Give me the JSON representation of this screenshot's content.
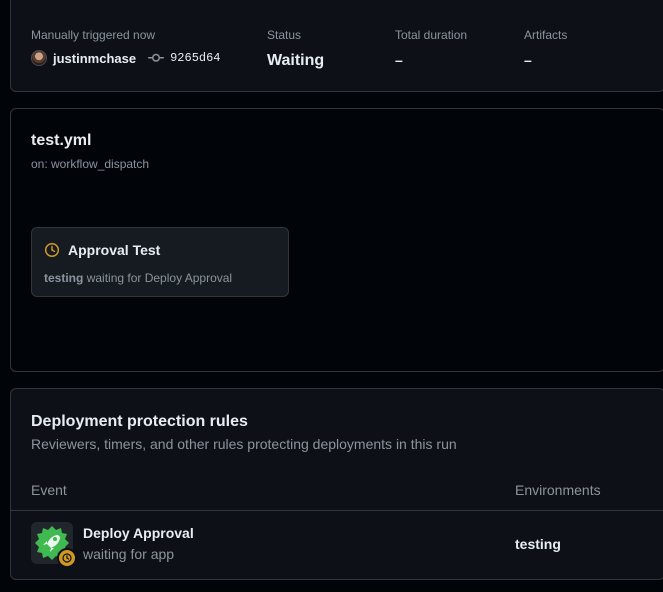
{
  "summary": {
    "trigger_label": "Manually triggered now",
    "actor": "justinmchase",
    "commit": "9265d64",
    "status_label": "Status",
    "status_value": "Waiting",
    "duration_label": "Total duration",
    "duration_value": "–",
    "artifacts_label": "Artifacts",
    "artifacts_value": "–"
  },
  "workflow": {
    "file": "test.yml",
    "trigger": "on: workflow_dispatch",
    "job": {
      "name": "Approval Test",
      "environment": "testing",
      "status_text": "waiting for Deploy Approval",
      "icon": "clock-icon",
      "status_color": "#d29922"
    }
  },
  "protection_rules": {
    "title": "Deployment protection rules",
    "subtitle": "Reviewers, timers, and other rules protecting deployments in this run",
    "columns": {
      "event": "Event",
      "environments": "Environments"
    },
    "rows": [
      {
        "name": "Deploy Approval",
        "status": "waiting for app",
        "environment": "testing",
        "icon": "rocket-badge-icon",
        "badge_color": "#3fb950"
      }
    ]
  },
  "colors": {
    "background": "#010409",
    "card": "#0d1117",
    "border": "#30363d",
    "text": "#e6edf3",
    "muted": "#8b949e",
    "waiting": "#d29922"
  }
}
